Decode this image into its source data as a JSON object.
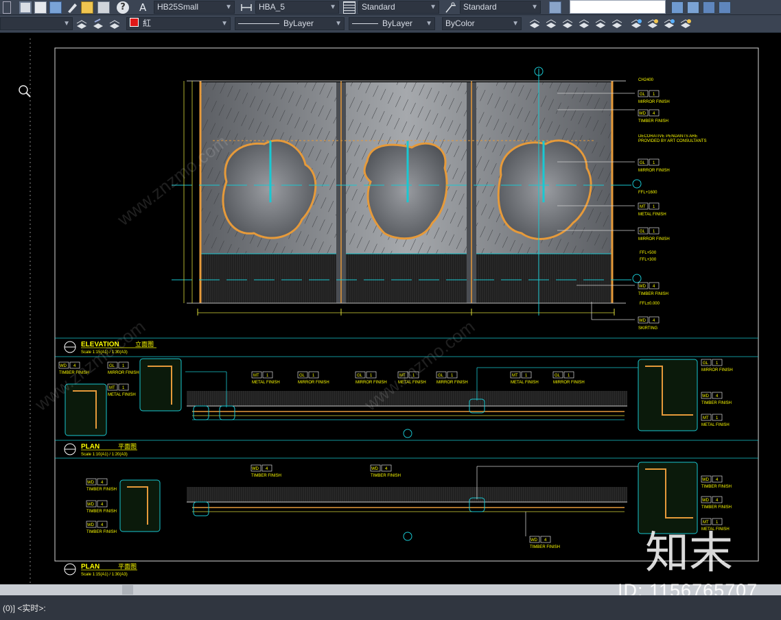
{
  "toolbar1": {
    "text_style": "HB25Small",
    "dim_style": "HBA_5",
    "table_style": "Standard",
    "mleader_style": "Standard"
  },
  "toolbar2": {
    "layer": "",
    "color_name": "紅",
    "linetype": "ByLayer",
    "lineweight": "ByLayer",
    "plotstyle": "ByColor"
  },
  "colors": {
    "layer_color": "#e01818",
    "cyan": "#19c8d2",
    "orange": "#e69a3a",
    "yellow": "#ffff00"
  },
  "drawing": {
    "elevation_title": "ELEVATION",
    "elevation_title_cn": "立面图",
    "elevation_scale": "Scale 1:15(A1) / 1:30(A3)",
    "plan1_title": "PLAN",
    "plan1_title_cn": "平面图",
    "plan1_scale": "Scale 1:10(A1) / 1:20(A3)",
    "plan2_title": "PLAN",
    "plan2_title_cn": "平面图",
    "plan2_scale": "Scale 1:15(A1) / 1:30(A3)",
    "note_pendants": "DECORATIVE PENDANTS ARE PROVIDED BY ART CONSULTANTS",
    "tags": {
      "gl": "GL",
      "wd": "WD",
      "mt": "MT",
      "mirror_finish": "MIRROR FINISH",
      "timber_finish": "TIMBER FINISH",
      "metal_finish": "METAL FINISH",
      "skirting": "SKIRTING"
    },
    "levels": [
      "CH2400",
      "FFL+1600",
      "FFL+500",
      "FFL+300",
      "FFL±0.000"
    ]
  },
  "watermark": {
    "brand": "知末",
    "id": "ID: 1156765707",
    "site": "www.znzmo.com"
  },
  "command": {
    "text": "(0)] <实时>:"
  }
}
